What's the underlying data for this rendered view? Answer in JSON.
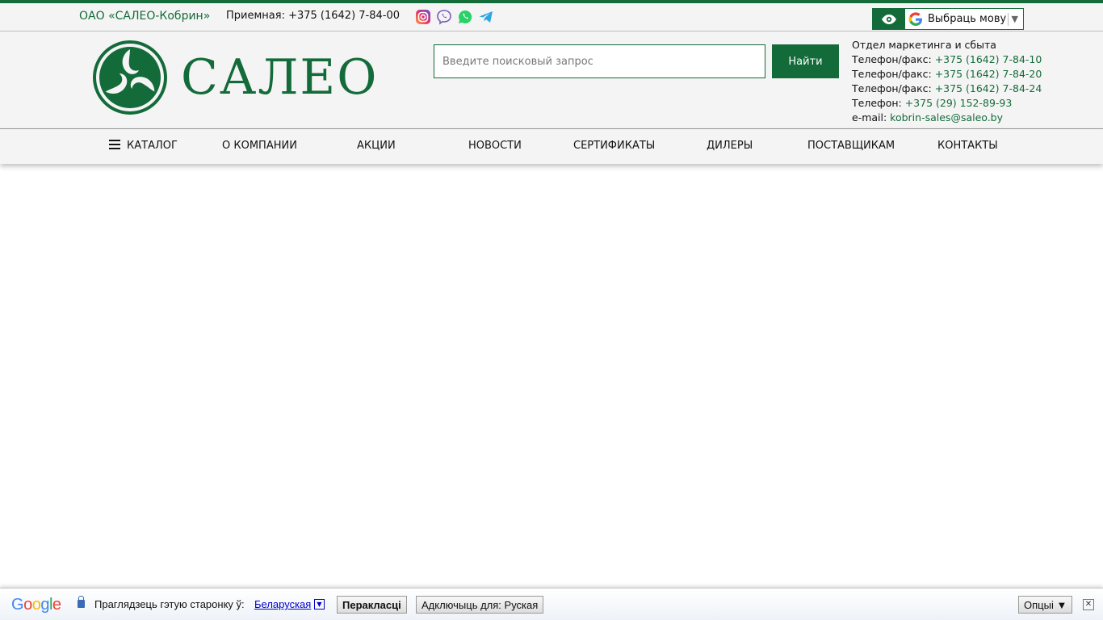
{
  "topbar": {
    "company": "ОАО «САЛЕО-Кобрин»",
    "reception": "Приемная: +375 (1642) 7-84-00",
    "socials": [
      "instagram-icon",
      "viber-icon",
      "whatsapp-icon",
      "telegram-icon"
    ],
    "language_select": "Выбраць мову"
  },
  "header": {
    "logo_text": "САЛЕО",
    "search_placeholder": "Введите поисковый запрос",
    "search_button": "Найти",
    "contacts": {
      "dept": "Отдел маркетинга и сбыта",
      "lines": [
        {
          "label": "Телефон/факс: ",
          "value": "+375 (1642) 7-84-10"
        },
        {
          "label": "Телефон/факс: ",
          "value": "+375 (1642) 7-84-20"
        },
        {
          "label": "Телефон/факс: ",
          "value": "+375 (1642) 7-84-24"
        },
        {
          "label": "Телефон: ",
          "value": "+375 (29) 152-89-93"
        },
        {
          "label": "e-mail: ",
          "value": "kobrin-sales@saleo.by"
        }
      ]
    }
  },
  "nav": {
    "items": [
      "Каталог",
      "О компании",
      "Акции",
      "Новости",
      "Сертификаты",
      "Дилеры",
      "Поставщикам",
      "Контакты"
    ]
  },
  "translate_bar": {
    "logo": "Google",
    "prompt": "Праглядзець гэтую старонку ў:",
    "language": "Беларуская",
    "translate_btn": "Перакласці",
    "disable_btn": "Адключыць для: Руская",
    "options_btn": "Опцыі ▼"
  },
  "colors": {
    "brand": "#146b3a"
  }
}
